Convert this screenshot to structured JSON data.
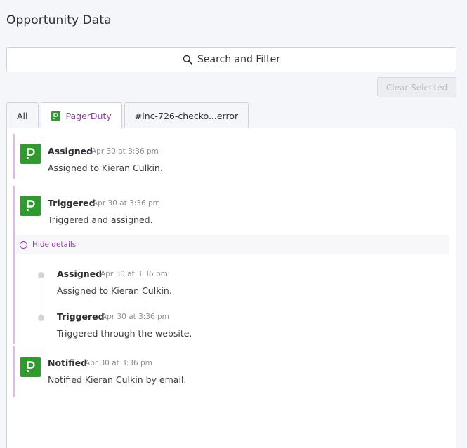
{
  "page": {
    "title": "Opportunity Data"
  },
  "search": {
    "label": "Search and Filter",
    "icon": "search-icon"
  },
  "toolbar": {
    "clear_label": "Clear Selected"
  },
  "tabs": [
    {
      "label": "All"
    },
    {
      "label": "PagerDuty",
      "icon": "pagerduty-icon",
      "active": true
    },
    {
      "label": "#inc-726-checko...error"
    }
  ],
  "events": [
    {
      "title": "Assigned",
      "time": "Apr 30 at 3:36 pm",
      "description": "Assigned to Kieran Culkin."
    },
    {
      "title": "Triggered",
      "time": "Apr 30 at 3:36 pm",
      "description": "Triggered and assigned.",
      "details_toggle": "Hide details",
      "details": [
        {
          "title": "Assigned",
          "time": "Apr 30 at 3:36 pm",
          "description": "Assigned to Kieran Culkin."
        },
        {
          "title": "Triggered",
          "time": "Apr 30 at 3:36 pm",
          "description": "Triggered through the website."
        }
      ]
    },
    {
      "title": "Notified",
      "time": "Apr 30 at 3:36 pm",
      "description": "Notified Kieran Culkin by email."
    }
  ],
  "colors": {
    "accent": "#8b3d9c",
    "pagerduty_green": "#2f9a2e",
    "event_bar": "#d7c1dc"
  }
}
